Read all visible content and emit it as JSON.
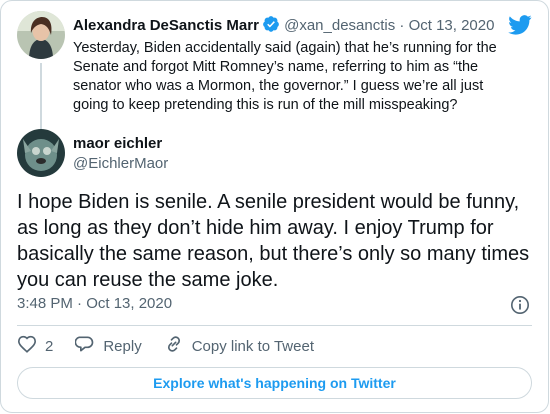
{
  "parent_tweet": {
    "author_name": "Alexandra DeSanctis Marr",
    "handle": "@xan_desanctis",
    "separator": "·",
    "date": "Oct 13, 2020",
    "text": "Yesterday, Biden accidentally said (again) that he’s running for the Senate and forgot Mitt Romney’s name, referring to him as “the senator who was a Mormon, the governor.” I guess we’re all just going to keep pretending this is run of the mill misspeaking?"
  },
  "reply_tweet": {
    "author_name": "maor eichler",
    "handle": "@EichlerMaor",
    "text": "I hope Biden is senile. A senile president would be funny, as long as they don’t hide him away. I enjoy Trump for basically the same reason, but there’s only so many times you can reuse the same joke.",
    "timestamp": "3:48 PM · Oct 13, 2020"
  },
  "actions": {
    "like_count": "2",
    "reply_label": "Reply",
    "copy_link_label": "Copy link to Tweet"
  },
  "footer": {
    "explore_label": "Explore what's happening on Twitter"
  },
  "icons": {
    "brand": "twitter-bird-icon",
    "verified": "verified-badge-icon",
    "info": "info-icon",
    "like": "heart-icon",
    "reply": "reply-bubble-icon",
    "link": "link-icon"
  },
  "colors": {
    "accent": "#1d9bf0",
    "text": "#0f1419",
    "muted": "#536471",
    "border": "#cfd9de"
  }
}
